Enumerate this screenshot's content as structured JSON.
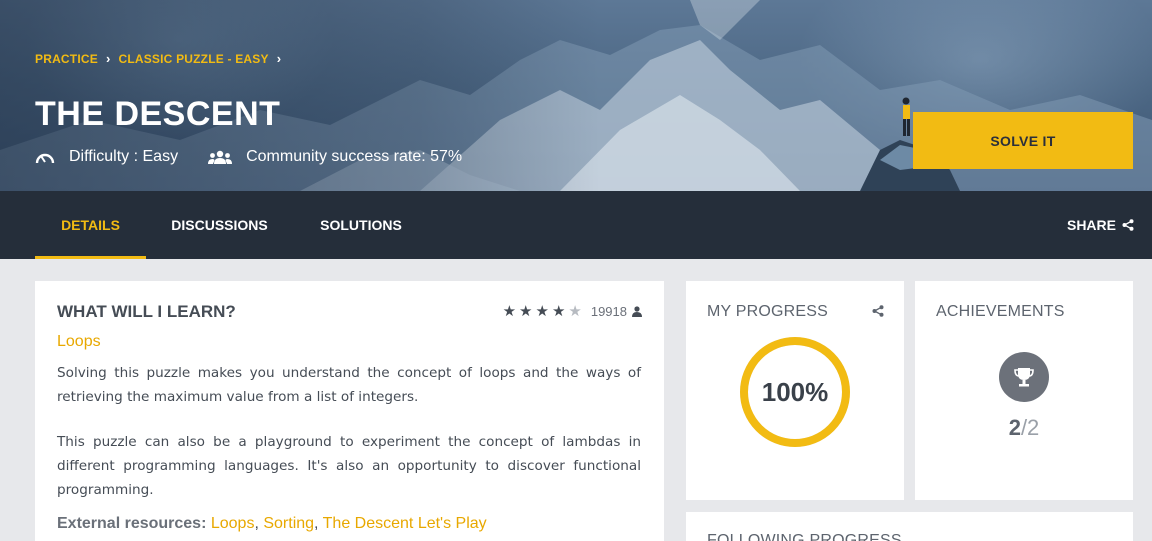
{
  "breadcrumb": [
    "PRACTICE",
    "CLASSIC PUZZLE - EASY"
  ],
  "puzzle": {
    "title": "THE DESCENT",
    "difficulty": "Difficulty : Easy",
    "success_rate": "Community success rate: 57%"
  },
  "solve_button": "SOLVE IT",
  "tabs": [
    {
      "label": "DETAILS",
      "active": true
    },
    {
      "label": "DISCUSSIONS",
      "active": false
    },
    {
      "label": "SOLUTIONS",
      "active": false
    }
  ],
  "share_label": "SHARE",
  "learn": {
    "heading": "WHAT WILL I LEARN?",
    "rating_stars": 4,
    "rating_count": "19918",
    "topic": "Loops",
    "paragraph1": "Solving this puzzle makes you understand the concept of loops and the ways of retrieving the maximum value from a list of integers.",
    "paragraph2": "This puzzle can also be a playground to experiment the concept of lambdas in different programming languages. It's also an opportunity to discover functional programming.",
    "resources_label": "External resources:",
    "resources": [
      "Loops",
      "Sorting",
      "The Descent Let's Play"
    ]
  },
  "progress": {
    "title": "MY PROGRESS",
    "percent": 100,
    "percent_label": "100%"
  },
  "achievements": {
    "title": "ACHIEVEMENTS",
    "done": "2",
    "total": "/2"
  },
  "following": {
    "title": "FOLLOWING PROGRESS"
  },
  "colors": {
    "accent": "#f2bb13",
    "tabbar": "#252e3a",
    "background": "#e7e8eb"
  },
  "icons": [
    "chevron-right-icon",
    "gauge-icon",
    "users-icon",
    "share-icon",
    "star-icon",
    "user-icon",
    "trophy-icon"
  ]
}
